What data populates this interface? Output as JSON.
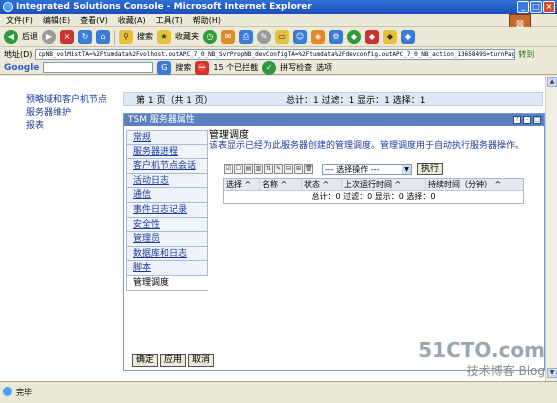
{
  "window": {
    "title": "Integrated Solutions Console - Microsoft Internet Explorer",
    "minimize": "_",
    "maximize": "□",
    "close": "×"
  },
  "menu": [
    "文件(F)",
    "编辑(E)",
    "查看(V)",
    "收藏(A)",
    "工具(T)",
    "帮助(H)"
  ],
  "toolbar": {
    "back": "后退",
    "search": "搜索",
    "favorites": "收藏夹"
  },
  "address": {
    "label": "地址(D)",
    "url": "cpNB_volMistTA=%2Ftumdata%2Fvolhost.outAPC_7_0_NB_SvrPropNB_devConfigTA=%2Ftumdata%2Fdevconfig.outAPC_7_0_NB_action_1365849S=turnPage%2810%29",
    "go": "转到"
  },
  "google": {
    "logo": "Google",
    "search": "搜索",
    "blocked": "15 个已拦截",
    "spell": "拼写检查",
    "options": "选项"
  },
  "left_nav": [
    "预略域和客户机节点",
    "服务器维护",
    "报表"
  ],
  "pager": {
    "page_info": "第 1 页（共 1 页）",
    "summary": "总计：1  过滤：1  显示：1  选择：1"
  },
  "props": {
    "title": "TSM 服务器属性",
    "tabs": [
      "常规",
      "服务器进程",
      "客户机节点会话",
      "活动日志",
      "通信",
      "事件日志记录",
      "安全性",
      "管理员",
      "数据库和日志",
      "脚本",
      "管理调度"
    ],
    "active_tab": "管理调度",
    "content_title": "管理调度",
    "content_desc": "该表显示已经为此服务器创建的管理调度。管理调度用于自动执行服务器操作。",
    "select_placeholder": "--- 选择操作 ---",
    "execute": "执行",
    "columns": [
      "选择 ^",
      "名称 ^",
      "状态 ^",
      "上次运行时间 ^",
      "持续时间（分钟） ^"
    ],
    "table_summary": "总计：0  过滤：0  显示：0  选择：0",
    "buttons": [
      "确定",
      "应用",
      "取消"
    ]
  },
  "status": {
    "text": "完毕"
  },
  "watermark": {
    "site": "51CTO.com",
    "sub": "技术博客  Blog"
  }
}
